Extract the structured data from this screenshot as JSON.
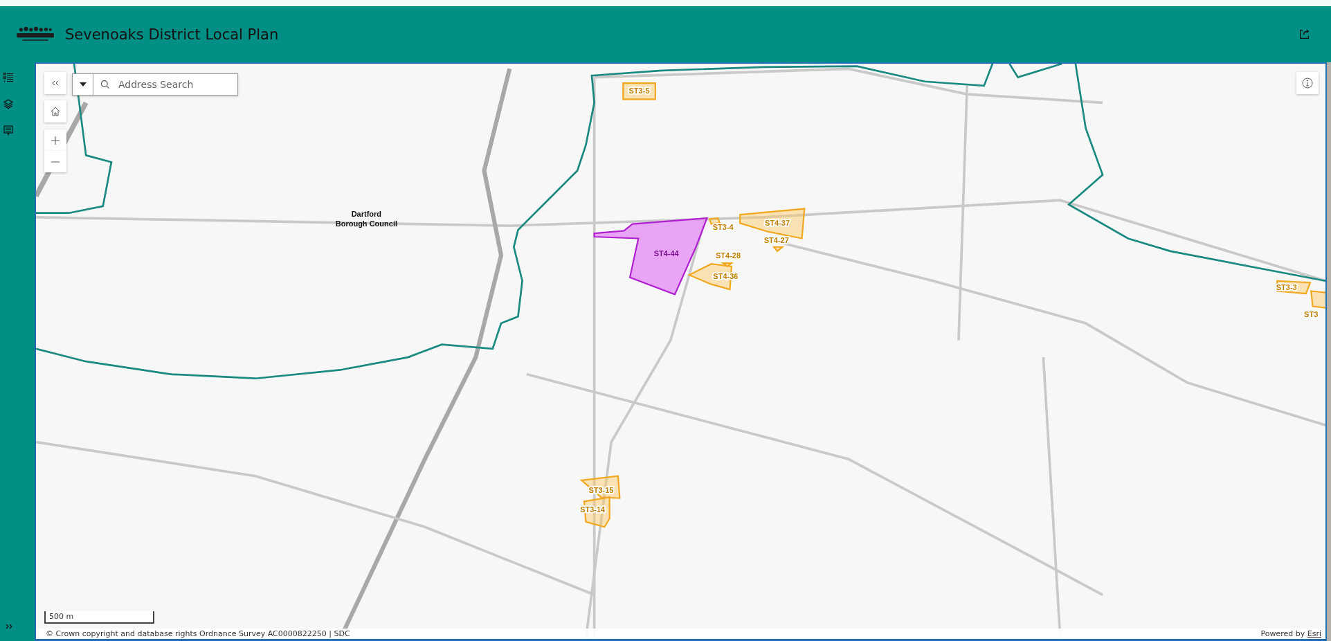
{
  "header": {
    "title": "Sevenoaks District Local Plan"
  },
  "search": {
    "placeholder": "Address Search"
  },
  "map": {
    "region_label": "Dartford Borough Council",
    "sites": [
      {
        "label": "ST3-5",
        "selected": false
      },
      {
        "label": "ST3-4",
        "selected": false
      },
      {
        "label": "ST4-37",
        "selected": false
      },
      {
        "label": "ST4-27",
        "selected": false
      },
      {
        "label": "ST4-44",
        "selected": true
      },
      {
        "label": "ST4-28",
        "selected": false
      },
      {
        "label": "ST4-36",
        "selected": false
      },
      {
        "label": "ST3-3",
        "selected": false
      },
      {
        "label": "ST3",
        "selected": false
      },
      {
        "label": "ST3-15",
        "selected": false
      },
      {
        "label": "ST3-14",
        "selected": false
      }
    ],
    "scale_bar": "500 m",
    "attribution": "© Crown copyright and database rights Ordnance Survey AC0000822250 | SDC",
    "powered_by": {
      "text": "Powered by",
      "link": "Esri"
    }
  }
}
